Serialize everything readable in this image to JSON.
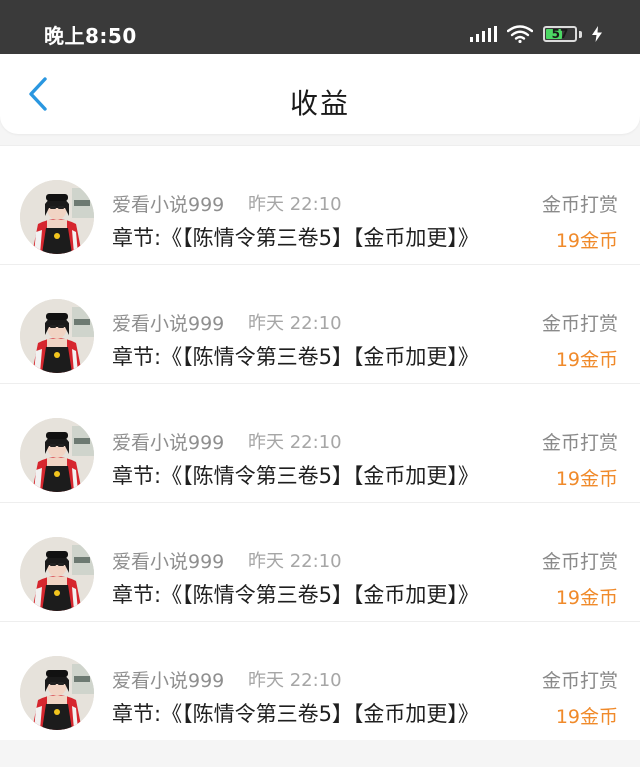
{
  "status_bar": {
    "time": "晚上8:50",
    "battery": "57",
    "battery_level": 0.57,
    "battery_color": "#4cd964"
  },
  "header": {
    "title": "收益",
    "back_icon": "chevron-left-icon",
    "accent_color": "#2a97e0"
  },
  "items": [
    {
      "username": "爱看小说999",
      "time": "昨天 22:10",
      "reward_type": "金币打赏",
      "chapter": "章节:《【陈情令第三卷5】【金币加更】》",
      "amount": "19金币"
    },
    {
      "username": "爱看小说999",
      "time": "昨天 22:10",
      "reward_type": "金币打赏",
      "chapter": "章节:《【陈情令第三卷5】【金币加更】》",
      "amount": "19金币"
    },
    {
      "username": "爱看小说999",
      "time": "昨天 22:10",
      "reward_type": "金币打赏",
      "chapter": "章节:《【陈情令第三卷5】【金币加更】》",
      "amount": "19金币"
    },
    {
      "username": "爱看小说999",
      "time": "昨天 22:10",
      "reward_type": "金币打赏",
      "chapter": "章节:《【陈情令第三卷5】【金币加更】》",
      "amount": "19金币"
    },
    {
      "username": "爱看小说999",
      "time": "昨天 22:10",
      "reward_type": "金币打赏",
      "chapter": "章节:《【陈情令第三卷5】【金币加更】》",
      "amount": "19金币"
    }
  ],
  "colors": {
    "amount": "#f08a2a",
    "status_bar_bg": "#3a3a3a"
  }
}
